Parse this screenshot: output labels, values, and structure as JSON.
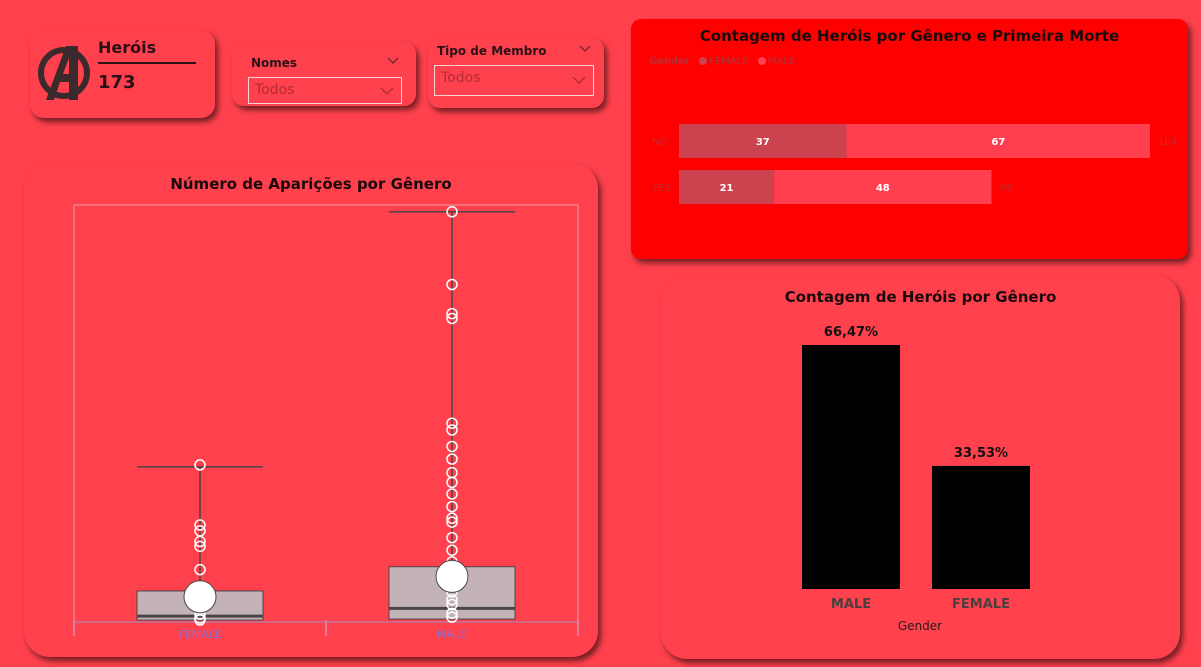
{
  "kpi": {
    "title": "Heróis",
    "value": "173"
  },
  "slicers": {
    "nomes": {
      "label": "Nomes",
      "selected": "Todos"
    },
    "tipo": {
      "label": "Tipo de Membro",
      "selected": "Todos"
    }
  },
  "colors": {
    "female_death": "#cc4350",
    "male_death": "#ff3f50",
    "bar": "#000000",
    "box_fill": "#c3b3b7",
    "box_line": "#4a4547",
    "stack_bg": "#ff0000"
  },
  "chart_data": [
    {
      "type": "bar",
      "orientation": "horizontal",
      "stacked": true,
      "title": "Contagem de Heróis por Gênero e Primeira Morte",
      "legend_title": "Gender",
      "legend_position": "top-left",
      "categories": [
        "NO",
        "YES"
      ],
      "series": [
        {
          "name": "FEMALE",
          "values": [
            37,
            21
          ]
        },
        {
          "name": "MALE",
          "values": [
            67,
            48
          ]
        }
      ],
      "totals": [
        104,
        69
      ],
      "xlim": [
        0,
        104
      ]
    },
    {
      "type": "box",
      "title": "Número de Aparições por Gênero",
      "categories": [
        "FEMALE",
        "MALE"
      ],
      "ylim": [
        0,
        4300
      ],
      "boxes": [
        {
          "name": "FEMALE",
          "whisker_low": 0,
          "q1": 20,
          "median": 60,
          "q3": 320,
          "whisker_high": 1600,
          "mean": 260,
          "outliers": [
            1620,
            1000,
            940,
            830,
            780,
            540,
            80,
            40,
            20
          ]
        },
        {
          "name": "MALE",
          "whisker_low": 0,
          "q1": 30,
          "median": 140,
          "q3": 570,
          "whisker_high": 4230,
          "mean": 470,
          "outliers": [
            4230,
            3480,
            3180,
            3130,
            2050,
            1980,
            1810,
            1680,
            1540,
            1440,
            1320,
            1190,
            1070,
            1030,
            870,
            740,
            620,
            310,
            230,
            180,
            90,
            50
          ]
        }
      ]
    },
    {
      "type": "bar",
      "title": "Contagem de Heróis por Gênero",
      "xlabel": "Gender",
      "categories": [
        "MALE",
        "FEMALE"
      ],
      "values": [
        66.47,
        33.53
      ],
      "labels": [
        "66,47%",
        "33,53%"
      ],
      "ylim": [
        0,
        66.47
      ]
    }
  ]
}
